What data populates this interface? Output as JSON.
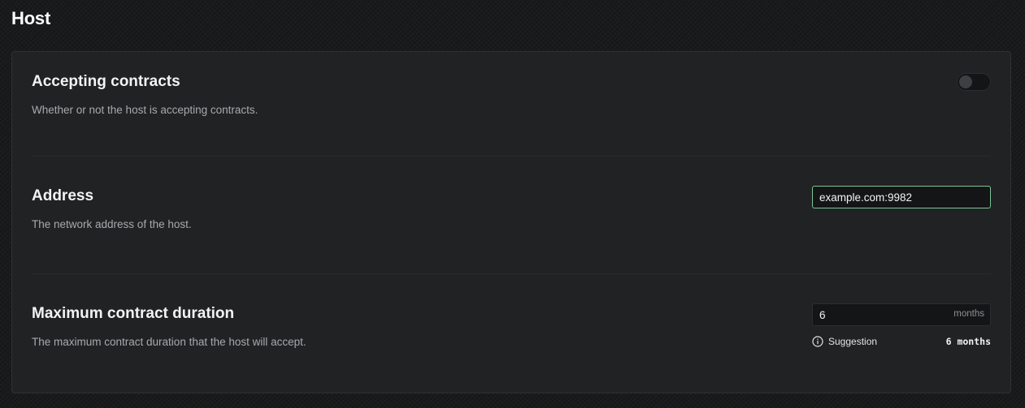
{
  "page": {
    "title": "Host"
  },
  "settings": [
    {
      "title": "Accepting contracts",
      "description": "Whether or not the host is accepting contracts.",
      "control": "toggle",
      "enabled": false
    },
    {
      "title": "Address",
      "description": "The network address of the host.",
      "control": "text",
      "value": "example.com:9982"
    },
    {
      "title": "Maximum contract duration",
      "description": "The maximum contract duration that the host will accept.",
      "control": "number",
      "value": "6",
      "unit": "months",
      "suggestion_label": "Suggestion",
      "suggestion_value": "6 months"
    }
  ],
  "colors": {
    "focus_border": "#7fc49a",
    "panel_bg": "#202223"
  },
  "icons": {
    "suggestion": "info-icon"
  }
}
